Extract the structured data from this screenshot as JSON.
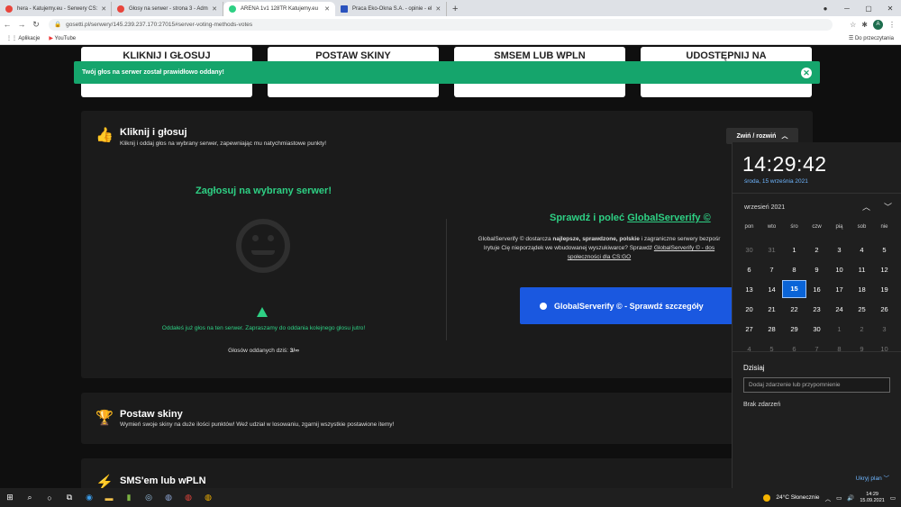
{
  "browser": {
    "tabs": [
      {
        "title": "hera - Katujemy.eu - Serwery CS:",
        "color": "#e8453c",
        "active": false
      },
      {
        "title": "Głosy na serwer - strona 3 - Adm",
        "color": "#e8453c",
        "active": false
      },
      {
        "title": "ARENA 1v1 128TR Katujemy.eu",
        "color": "#2ed084",
        "active": true
      },
      {
        "title": "Praca Eko-Okna S.A. - opinie - el",
        "color": "#2a52be",
        "active": false
      }
    ],
    "url": "gosetti.pl/serwery/145.239.237.170:27015#server-voting-methods-votes",
    "avatar_letter": "A",
    "bookmarks": [
      "Aplikacje",
      "YouTube"
    ],
    "reading_list": "Do przeczytania"
  },
  "site": {
    "top_cards": [
      "KLIKNIJ I GŁOSUJ",
      "POSTAW SKINY",
      "SMSEM LUB WPLN",
      "UDOSTĘPNIJ NA"
    ],
    "alert": "Twój głos na serwer został prawidłowo oddany!",
    "vote_panel": {
      "title": "Kliknij i głosuj",
      "subtitle": "Kliknij i oddaj głos na wybrany serwer, zapewniając mu natychmiastowe punkty!",
      "toggle": "Zwiń / rozwiń",
      "vote_heading": "Zagłosuj na wybrany serwer!",
      "warning": "Oddałeś już głos na ten serwer. Zapraszamy do oddania kolejnego głosu jutro!",
      "votes_label": "Głosów oddanych dziś:",
      "votes_value": "3/∞",
      "gs_title_prefix": "Sprawdź i poleć",
      "gs_title_link": "GlobalServerify ©",
      "gs_line1_a": "GlobalServerify © dostarcza",
      "gs_line1_b": "najlepsze, sprawdzone, polskie",
      "gs_line1_c": "i zagraniczne serwery bezpośr",
      "gs_line2_a": "Irytuje Cię nieporządek we wbudowanej wyszukiwarce? Sprawdź",
      "gs_line2_link": "GlobalServerify © - dos",
      "gs_line3": "społeczności dla CS:GO",
      "gs_button": "GlobalServerify © - Sprawdź szczegóły"
    },
    "skins_panel": {
      "title": "Postaw skiny",
      "subtitle": "Wymień swoje skiny na duże ilości punktów! Weź udział w losowaniu, zgarnij wszystkie postawione itemy!"
    },
    "sms_panel": {
      "title": "SMS'em lub wPLN"
    }
  },
  "calendar": {
    "time": "14:29:42",
    "date": "środa, 15 września 2021",
    "month": "wrzesień 2021",
    "weekdays": [
      "pon",
      "wto",
      "śro",
      "czw",
      "pią",
      "sob",
      "nie"
    ],
    "weeks": [
      [
        "30",
        "31",
        "1",
        "2",
        "3",
        "4",
        "5"
      ],
      [
        "6",
        "7",
        "8",
        "9",
        "10",
        "11",
        "12"
      ],
      [
        "13",
        "14",
        "15",
        "16",
        "17",
        "18",
        "19"
      ],
      [
        "20",
        "21",
        "22",
        "23",
        "24",
        "25",
        "26"
      ],
      [
        "27",
        "28",
        "29",
        "30",
        "1",
        "2",
        "3"
      ],
      [
        "4",
        "5",
        "6",
        "7",
        "8",
        "9",
        "10"
      ]
    ],
    "today_label": "Dzisiaj",
    "event_placeholder": "Dodaj zdarzenie lub przypomnienie",
    "no_events": "Brak zdarzeń",
    "hide_plan": "Ukryj plan"
  },
  "taskbar": {
    "weather": "24°C  Słonecznie",
    "time": "14:29",
    "date": "15.09.2021"
  }
}
